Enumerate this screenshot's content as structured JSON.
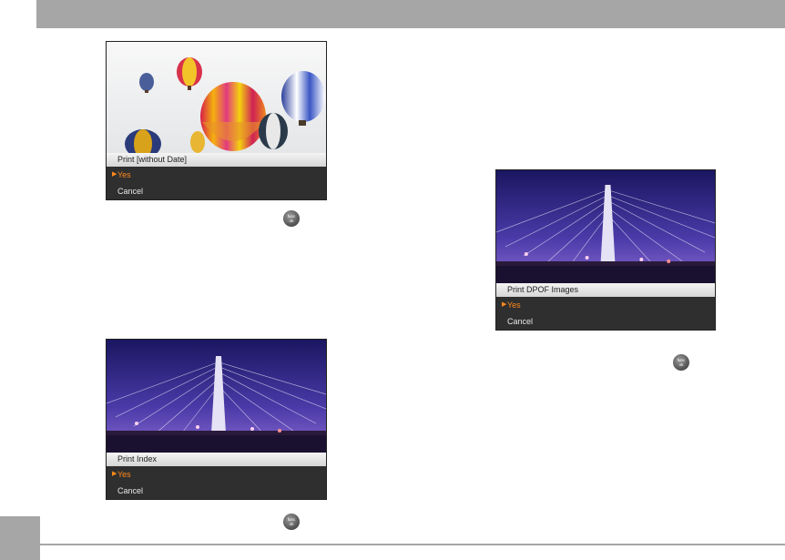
{
  "screens": {
    "balloons": {
      "menu_title": "Print [without Date]",
      "options": [
        {
          "label": "Yes",
          "selected": true
        },
        {
          "label": "Cancel",
          "selected": false
        }
      ]
    },
    "index": {
      "menu_title": "Print Index",
      "options": [
        {
          "label": "Yes",
          "selected": true
        },
        {
          "label": "Cancel",
          "selected": false
        }
      ]
    },
    "dpof": {
      "menu_title": "Print DPOF Images",
      "options": [
        {
          "label": "Yes",
          "selected": true
        },
        {
          "label": "Cancel",
          "selected": false
        }
      ]
    }
  },
  "func_button": {
    "line1": "func",
    "line2": "ok"
  },
  "colors": {
    "header_bar": "#a6a6a6",
    "menu_background": "#2f2f2f",
    "selection": "#ff8a1a"
  }
}
